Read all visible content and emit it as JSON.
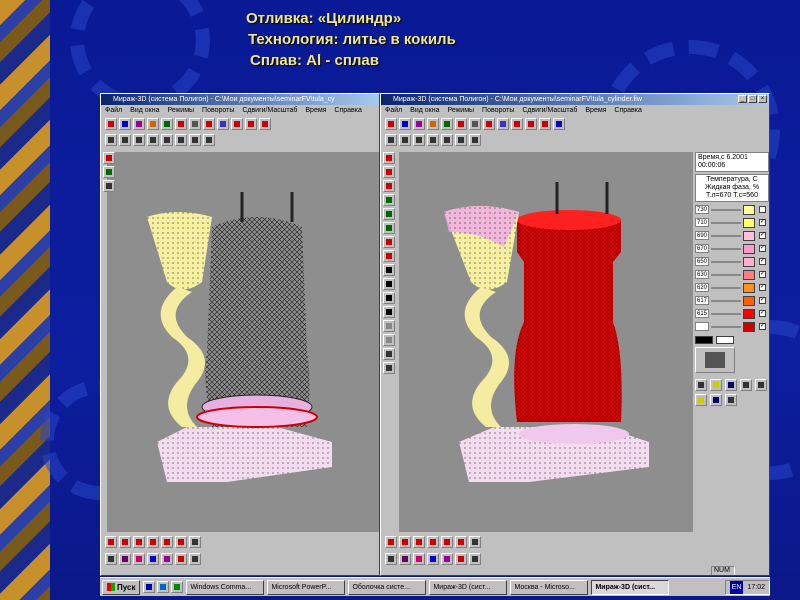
{
  "slide": {
    "title_line1": "Отливка: «Цилиндр»",
    "title_line2": "Технология: литье в кокиль",
    "title_line3": "Сплав: Al - сплав"
  },
  "left_window": {
    "title": "Мираж-3D (система Полигон) - C:\\Мои документы\\seminarFV\\tula_cy",
    "menu": [
      "Файл",
      "Вид окна",
      "Режимы",
      "Повороты",
      "Сдвиги/Масштаб",
      "Время",
      "Справка"
    ]
  },
  "right_window": {
    "title": "Мираж-3D (система Полигон) - C:\\Мои документы\\seminarFV\\tula_cylinder.fiw",
    "menu": [
      "Файл",
      "Вид окна",
      "Режимы",
      "Повороты",
      "Сдвиги/Масштаб",
      "Время",
      "Справка"
    ],
    "panel": {
      "time_line1": "Время,с 6.2001",
      "time_line2": "00:00:06",
      "legend_title_line1": "Температура, С",
      "legend_title_line2": "Жидкая фаза, %",
      "legend_title_line3": "T.л=670 T.c=560",
      "legend": [
        {
          "value": "730",
          "color": "#ffff99",
          "checked": false
        },
        {
          "value": "710",
          "color": "#ffff66",
          "checked": true
        },
        {
          "value": "690",
          "color": "#ffc0e0",
          "checked": true
        },
        {
          "value": "670",
          "color": "#ff99cc",
          "checked": true
        },
        {
          "value": "650",
          "color": "#ffb0d0",
          "checked": true
        },
        {
          "value": "630",
          "color": "#ff8080",
          "checked": true
        },
        {
          "value": "620",
          "color": "#ff9020",
          "checked": true
        },
        {
          "value": "617",
          "color": "#ff6000",
          "checked": true
        },
        {
          "value": "615",
          "color": "#ff0000",
          "checked": true
        },
        {
          "value": "",
          "color": "#d00000",
          "checked": true
        }
      ]
    },
    "status_num": "NUM"
  },
  "taskbar": {
    "start_label": "Пуск",
    "tasks": [
      {
        "label": "Windows Comma...",
        "active": false
      },
      {
        "label": "Microsoft PowerP...",
        "active": false
      },
      {
        "label": "Оболочка систе...",
        "active": false
      },
      {
        "label": "Мираж-3D (сист...",
        "active": false
      },
      {
        "label": "Москва - Microso...",
        "active": false
      },
      {
        "label": "Мираж-3D (сист...",
        "active": true
      }
    ],
    "lang": "EN",
    "clock": "17:02"
  },
  "colors": {
    "title_text": "#f2e88a",
    "slide_bg": "#0a1a96",
    "viewport_bg": "#8e8e8e",
    "hot_metal": "#e00000",
    "funnel": "#f6f0a0"
  }
}
